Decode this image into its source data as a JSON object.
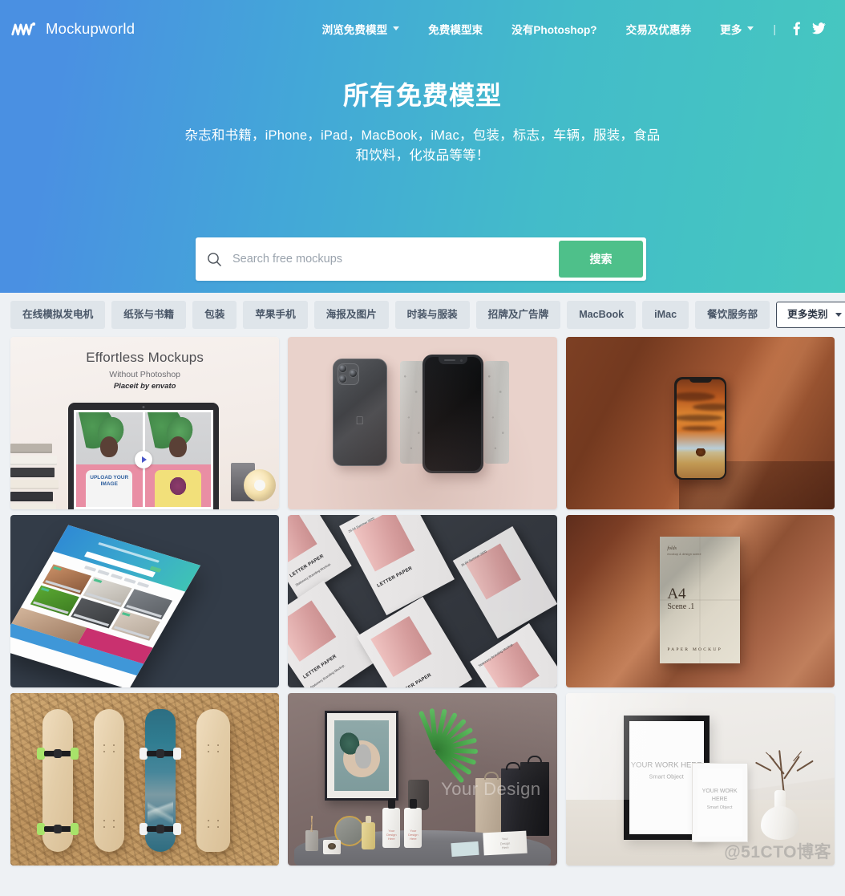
{
  "site": {
    "brand_name": "Mockupworld",
    "logo_icon": "mockupworld-zigzag-logo"
  },
  "nav": {
    "items": [
      {
        "label": "浏览免费模型",
        "has_dropdown": true
      },
      {
        "label": "免费模型束",
        "has_dropdown": false
      },
      {
        "label": "没有Photoshop?",
        "has_dropdown": false
      },
      {
        "label": "交易及优惠券",
        "has_dropdown": false
      },
      {
        "label": "更多",
        "has_dropdown": true
      }
    ],
    "separator": "|",
    "social": [
      {
        "name": "facebook-icon"
      },
      {
        "name": "twitter-icon"
      }
    ]
  },
  "hero": {
    "title": "所有免费模型",
    "subtitle": "杂志和书籍，iPhone，iPad，MacBook，iMac，包装，标志，车辆，服装，食品和饮料，化妆品等等！",
    "gradient_start": "#4a90e2",
    "gradient_end": "#46c8bf"
  },
  "search": {
    "placeholder": "Search free mockups",
    "value": "",
    "button_label": "搜索",
    "button_color": "#4ec08a",
    "icon": "search-icon"
  },
  "filters": {
    "chips": [
      "在线模拟发电机",
      "纸张与书籍",
      "包装",
      "苹果手机",
      "海报及图片",
      "时装与服装",
      "招牌及广告牌",
      "MacBook",
      "iMac",
      "餐饮服务部"
    ],
    "more_label": "更多类别",
    "chip_bg": "#dfe5ea",
    "chip_text": "#4a5768"
  },
  "grid": {
    "cards": [
      {
        "id": "card-placeit-ad",
        "kind": "sponsored-ad",
        "ad_title": "Effortless Mockups",
        "ad_subtitle": "Without Photoshop",
        "ad_brand": "Placeit by envato",
        "shirt_text": "UPLOAD YOUR IMAGE"
      },
      {
        "id": "card-iphone-pink",
        "kind": "mockup",
        "alt": "iPhone front and back on pink background with concrete blocks"
      },
      {
        "id": "card-iphone-sunset",
        "kind": "mockup",
        "alt": "iPhone with sunset wallpaper on terracotta wall"
      },
      {
        "id": "card-website-slate",
        "kind": "mockup",
        "alt": "Perspective web page mockup on dark slate"
      },
      {
        "id": "card-letter-paper",
        "kind": "mockup",
        "alt": "Stationery branding letter paper mockups",
        "labels": [
          "LETTER PAPER",
          "Stationery Branding Mockup.",
          "26.04 Summer 2020"
        ]
      },
      {
        "id": "card-a4-paper",
        "kind": "mockup",
        "alt": "A4 folded paper mockup on copper backdrop",
        "title": "A4",
        "scene": "Scene .1",
        "footer": "PAPER MOCKUP",
        "folds_label": "folds"
      },
      {
        "id": "card-skateboards",
        "kind": "mockup",
        "alt": "Four skateboard decks on OSB wood panel"
      },
      {
        "id": "card-branding-scene",
        "kind": "mockup",
        "alt": "Branding scene with poster, palm, bottles and bags",
        "overlay_text": "Your Design"
      },
      {
        "id": "card-frames-vase",
        "kind": "mockup",
        "alt": "Black and white picture frames with vase",
        "frame_text": "YOUR WORK HERE",
        "frame_sub": "Smart Object"
      }
    ]
  },
  "watermark": "@51CTO博客"
}
